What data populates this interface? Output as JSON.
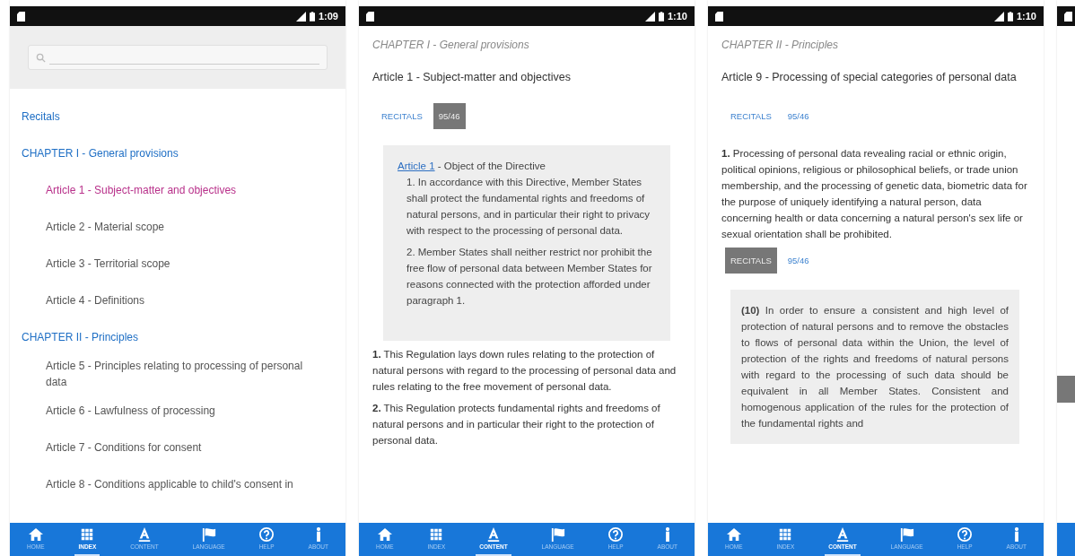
{
  "phones": [
    {
      "kind": "index",
      "time": "1:09",
      "items": [
        {
          "kind": "section",
          "label": "Recitals",
          "selected": false
        },
        {
          "kind": "section",
          "label": "CHAPTER I - General provisions",
          "selected": false
        },
        {
          "kind": "article",
          "label": "Article 1 - Subject-matter and objectives",
          "selected": true
        },
        {
          "kind": "article",
          "label": "Article 2 - Material scope",
          "selected": false
        },
        {
          "kind": "article",
          "label": "Article 3 - Territorial scope",
          "selected": false
        },
        {
          "kind": "article",
          "label": "Article 4 - Definitions",
          "selected": false
        },
        {
          "kind": "section",
          "label": "CHAPTER II - Principles",
          "selected": false
        },
        {
          "kind": "article",
          "label": "Article 5 - Principles relating to processing of personal data",
          "selected": false
        },
        {
          "kind": "article",
          "label": "Article 6 - Lawfulness of processing",
          "selected": false
        },
        {
          "kind": "article",
          "label": "Article 7 - Conditions for consent",
          "selected": false
        },
        {
          "kind": "article",
          "label": "Article 8 - Conditions applicable to child's consent in",
          "selected": false
        }
      ],
      "nav": [
        {
          "label": "HOME",
          "selected": false
        },
        {
          "label": "INDEX",
          "selected": true
        },
        {
          "label": "CONTENT",
          "selected": false
        },
        {
          "label": "LANGUAGE",
          "selected": false
        },
        {
          "label": "HELP",
          "selected": false
        },
        {
          "label": "ABOUT",
          "selected": false
        }
      ]
    },
    {
      "kind": "article",
      "time": "1:10",
      "chapter": "CHAPTER I - General provisions",
      "title": "Article 1 - Subject-matter and objectives",
      "blocks": [
        {
          "kind": "toggles",
          "options": [
            {
              "label": "RECITALS",
              "selected": false
            },
            {
              "label": "95/46",
              "selected": true
            }
          ]
        },
        {
          "kind": "quote",
          "link": "Article 1",
          "heading": " - Object of the Directive",
          "paragraphs": [
            "1. In accordance with this Directive, Member States shall protect the fundamental rights and freedoms of natural persons, and in particular their right to privacy with respect to the processing of personal data.",
            "2. Member States shall neither restrict nor prohibit the free flow of personal data between Member States for reasons connected with the protection afforded under paragraph 1."
          ]
        },
        {
          "kind": "paragraph",
          "text": "**1.** This Regulation lays down rules relating to the protection of natural persons with regard to the processing of personal data and rules relating to the free movement of personal data."
        },
        {
          "kind": "paragraph",
          "text": "**2.** This Regulation protects fundamental rights and freedoms of natural persons and in particular their right to the protection of personal data."
        }
      ],
      "nav": [
        {
          "label": "HOME",
          "selected": false
        },
        {
          "label": "INDEX",
          "selected": false
        },
        {
          "label": "CONTENT",
          "selected": true
        },
        {
          "label": "LANGUAGE",
          "selected": false
        },
        {
          "label": "HELP",
          "selected": false
        },
        {
          "label": "ABOUT",
          "selected": false
        }
      ]
    },
    {
      "kind": "article",
      "time": "1:10",
      "chapter": "CHAPTER II - Principles",
      "title": "Article 9 - Processing of special categories of personal data",
      "blocks": [
        {
          "kind": "toggles",
          "options": [
            {
              "label": "RECITALS",
              "selected": false
            },
            {
              "label": "95/46",
              "selected": false
            }
          ]
        },
        {
          "kind": "paragraph",
          "text": "**1.** Processing of personal data revealing racial or ethnic origin, political opinions, religious or philosophical beliefs, or trade union membership, and the processing of genetic data, biometric data for the purpose of uniquely identifying a natural person, data concerning health or data concerning a natural person's sex life or sexual orientation shall be prohibited."
        },
        {
          "kind": "toggles",
          "options": [
            {
              "label": "RECITALS",
              "selected": true
            },
            {
              "label": "95/46",
              "selected": false
            }
          ]
        },
        {
          "kind": "recital",
          "text": "**(10)** In order to ensure a consistent and high level of protection of natural persons and to remove the obstacles to flows of personal data within the Union, the level of protection of the rights and freedoms of natural persons with regard to the processing of such data should be equivalent in all Member States. Consistent and homogenous application of the rules for the protection of the fundamental rights and"
        }
      ],
      "nav": [
        {
          "label": "HOME",
          "selected": false
        },
        {
          "label": "INDEX",
          "selected": false
        },
        {
          "label": "CONTENT",
          "selected": true
        },
        {
          "label": "LANGUAGE",
          "selected": false
        },
        {
          "label": "HELP",
          "selected": false
        },
        {
          "label": "ABOUT",
          "selected": false
        }
      ]
    },
    {
      "kind": "partial"
    }
  ]
}
